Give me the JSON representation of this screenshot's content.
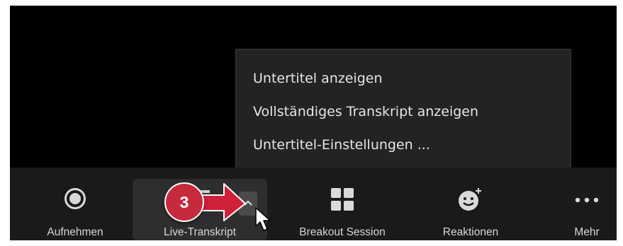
{
  "menu": {
    "items": [
      {
        "label": "Untertitel anzeigen"
      },
      {
        "label": "Vollständiges Transkript anzeigen"
      },
      {
        "label": "Untertitel-Einstellungen ..."
      }
    ]
  },
  "toolbar": {
    "record_label": "Aufnehmen",
    "live_transcript_label": "Live-Transkript",
    "breakout_label": "Breakout Session",
    "reactions_label": "Reaktionen",
    "more_label": "Mehr"
  },
  "annotation": {
    "step_number": "3",
    "badge_color": "#c72a3d"
  },
  "colors": {
    "screen_background": "#000000",
    "toolbar_background": "#1a1a1a",
    "menu_background": "#232323",
    "selected_tool_background": "#2e2e2e",
    "text": "#d8d8d8"
  },
  "icons": {
    "record": "record-icon",
    "live_transcript_options": "chevron-up-icon",
    "breakout": "grid-icon",
    "reactions": "smiley-plus-icon",
    "more": "more-dots-icon",
    "pointer": "mouse-cursor-icon",
    "callout": "red-arrow-icon"
  }
}
